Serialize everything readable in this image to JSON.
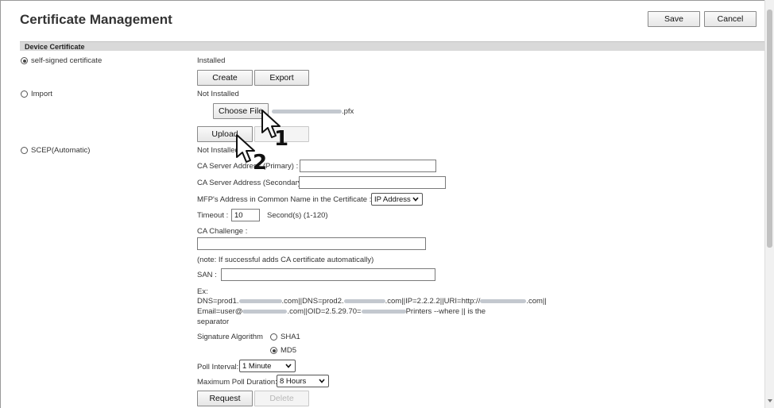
{
  "header": {
    "title": "Certificate Management",
    "save_label": "Save",
    "cancel_label": "Cancel"
  },
  "section": {
    "title": "Device Certificate"
  },
  "options": {
    "self_signed": {
      "label": "self-signed certificate",
      "status": "Installed",
      "create_label": "Create",
      "export_label": "Export"
    },
    "import": {
      "label": "Import",
      "status": "Not Installed",
      "choose_file_label": "Choose File",
      "file_suffix": ".pfx",
      "upload_label": "Upload"
    },
    "scep": {
      "label": "SCEP(Automatic)",
      "status": "Not Installed"
    }
  },
  "scep_form": {
    "ca_primary_label": "CA Server Address (Primary)  :",
    "ca_primary_value": "",
    "ca_secondary_label": "CA Server Address (Secondary)  :",
    "ca_secondary_value": "",
    "mfp_label": "MFP's Address in Common Name in the Certificate  :",
    "mfp_value": "IP Address",
    "timeout_label": "Timeout  :",
    "timeout_value": "10",
    "timeout_unit": "Second(s) (1-120)",
    "challenge_label": "CA Challenge  :",
    "challenge_value": "",
    "note": "(note: If successful adds CA certificate automatically)",
    "san_label": "SAN  :",
    "san_value": "",
    "ex_label": "Ex:",
    "ex_line1_a": "DNS=prod1.",
    "ex_line1_b": ".com||DNS=prod2.",
    "ex_line1_c": ".com||IP=2.2.2.2||URI=http://",
    "ex_line1_d": ".com||",
    "ex_line2_a": "Email=user@",
    "ex_line2_b": ".com||OID=2.5.29.70=",
    "ex_line2_c": "Printers --where || is the",
    "ex_line3": "separator",
    "sig_label": "Signature Algorithm",
    "sig_sha1": "SHA1",
    "sig_md5": "MD5",
    "poll_label": "Poll Interval:",
    "poll_value": "1 Minute",
    "max_poll_label": "Maximum Poll Duration:",
    "max_poll_value": "8 Hours",
    "request_label": "Request",
    "delete_label": "Delete"
  },
  "annotations": {
    "step1": "1",
    "step2": "2"
  }
}
